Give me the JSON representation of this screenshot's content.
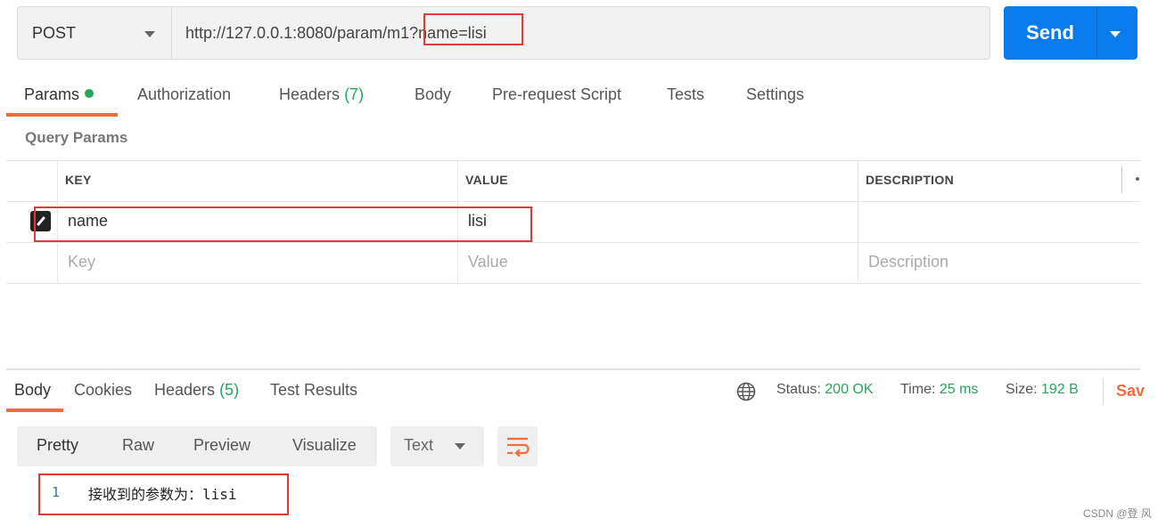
{
  "request": {
    "method": "POST",
    "url": "http://127.0.0.1:8080/param/m1?name=lisi",
    "send_label": "Send"
  },
  "request_tabs": {
    "params": "Params",
    "authorization": "Authorization",
    "headers": "Headers",
    "headers_count": "(7)",
    "body": "Body",
    "prerequest": "Pre-request Script",
    "tests": "Tests",
    "settings": "Settings"
  },
  "query_params": {
    "title": "Query Params",
    "columns": {
      "key": "KEY",
      "value": "VALUE",
      "description": "DESCRIPTION"
    },
    "rows": [
      {
        "key": "name",
        "value": "lisi",
        "description": ""
      }
    ],
    "placeholder": {
      "key": "Key",
      "value": "Value",
      "description": "Description"
    }
  },
  "response_tabs": {
    "body": "Body",
    "cookies": "Cookies",
    "headers": "Headers",
    "headers_count": "(5)",
    "test_results": "Test Results"
  },
  "response_meta": {
    "status_label": "Status:",
    "status_value": "200 OK",
    "time_label": "Time:",
    "time_value": "25 ms",
    "size_label": "Size:",
    "size_value": "192 B",
    "save_label": "Sav"
  },
  "formats": {
    "pretty": "Pretty",
    "raw": "Raw",
    "preview": "Preview",
    "visualize": "Visualize",
    "type": "Text"
  },
  "response_body": {
    "line_no": "1",
    "text": "接收到的参数为：lisi"
  },
  "watermark": "CSDN @登 风",
  "colors": {
    "accent": "#f26b3a",
    "send": "#097bed",
    "success": "#26a65b",
    "highlight": "#e53935"
  }
}
